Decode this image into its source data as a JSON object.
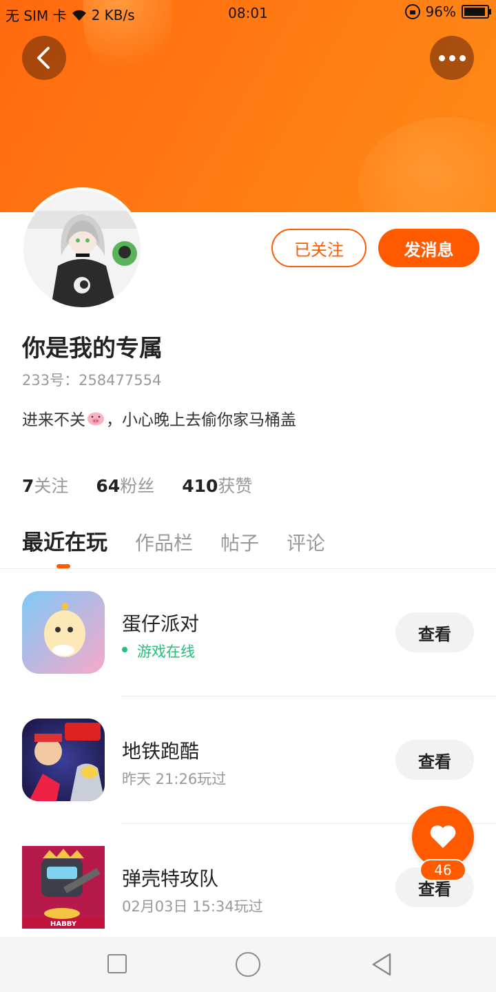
{
  "status_bar": {
    "sim": "无 SIM 卡",
    "net_speed": "2 KB/s",
    "time": "08:01",
    "battery": "96%"
  },
  "colors": {
    "accent": "#ff5a00",
    "banner": "#ff7a12",
    "online": "#22c07a"
  },
  "profile": {
    "follow_button": "已关注",
    "message_button": "发消息",
    "username": "你是我的专属",
    "id_line": "233号：258477554",
    "bio_before": "进来不关",
    "bio_after": "，小心晚上去偷你家马桶盖",
    "stats": [
      {
        "num": "7",
        "label": "关注"
      },
      {
        "num": "64",
        "label": "粉丝"
      },
      {
        "num": "410",
        "label": "获赞"
      }
    ]
  },
  "tabs": [
    "最近在玩",
    "作品栏",
    "帖子",
    "评论"
  ],
  "games": [
    {
      "name": "蛋仔派对",
      "sub": "游戏在线",
      "button": "查看"
    },
    {
      "name": "地铁跑酷",
      "sub": "昨天 21:26玩过",
      "button": "查看"
    },
    {
      "name": "弹壳特攻队",
      "sub": "02月03日 15:34玩过",
      "button": "查看"
    }
  ],
  "game3_logo_text": "HABBY",
  "like_count": "46",
  "icons": [
    "back-arrow-icon",
    "more-dots-icon",
    "wifi-icon",
    "lock-rotation-icon",
    "battery-icon",
    "heart-icon",
    "nav-square-icon",
    "nav-home-icon",
    "nav-back-icon"
  ]
}
